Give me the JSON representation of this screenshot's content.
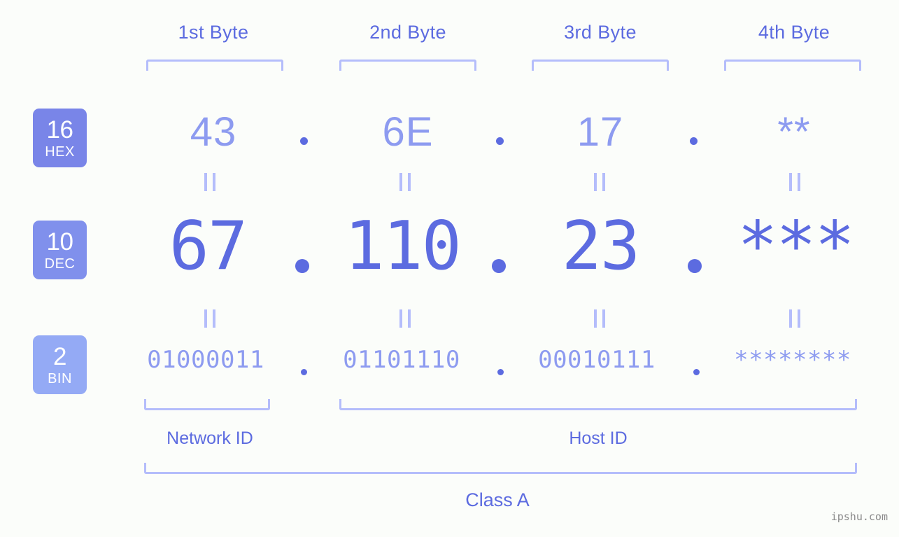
{
  "background_color": "#fbfdfa",
  "accent_color": "#5c6be0",
  "accent_light_color": "#8d9bf0",
  "bracket_color": "#b4bdfb",
  "byte_headers": [
    {
      "label": "1st Byte"
    },
    {
      "label": "2nd Byte"
    },
    {
      "label": "3rd Byte"
    },
    {
      "label": "4th Byte"
    }
  ],
  "rows": [
    {
      "badge_number": "16",
      "badge_label": "HEX",
      "badge_color": "#7985e8",
      "values": [
        "43",
        "6E",
        "17",
        "**"
      ],
      "separator": "."
    },
    {
      "badge_number": "10",
      "badge_label": "DEC",
      "badge_color": "#8090ec",
      "values": [
        "67",
        "110",
        "23",
        "***"
      ],
      "separator": "."
    },
    {
      "badge_number": "2",
      "badge_label": "BIN",
      "badge_color": "#94aaf5",
      "values": [
        "01000011",
        "01101110",
        "00010111",
        "********"
      ],
      "separator": "."
    }
  ],
  "equals_marker": "||",
  "sections": {
    "network_id": "Network ID",
    "host_id": "Host ID",
    "class": "Class A"
  },
  "watermark": "ipshu.com",
  "chart_data": {
    "type": "table",
    "title": "IP address byte breakdown",
    "categories": [
      "1st Byte",
      "2nd Byte",
      "3rd Byte",
      "4th Byte"
    ],
    "series": [
      {
        "name": "HEX",
        "values": [
          "43",
          "6E",
          "17",
          "**"
        ]
      },
      {
        "name": "DEC",
        "values": [
          "67",
          "110",
          "23",
          "***"
        ]
      },
      {
        "name": "BIN",
        "values": [
          "01000011",
          "01101110",
          "00010111",
          "********"
        ]
      }
    ],
    "annotations": [
      "Network ID",
      "Host ID",
      "Class A"
    ]
  }
}
